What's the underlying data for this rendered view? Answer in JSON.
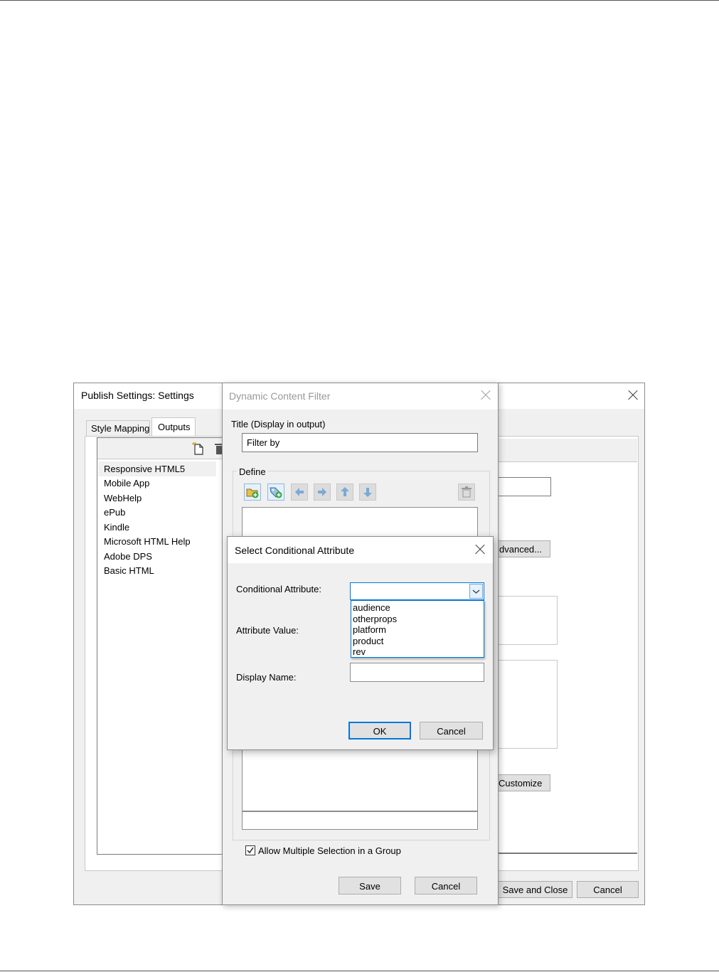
{
  "publish_settings": {
    "title": "Publish Settings: Settings",
    "tabs": [
      "Style Mapping",
      "Outputs"
    ],
    "outputs": [
      "Responsive HTML5",
      "Mobile App",
      "WebHelp",
      "ePub",
      "Kindle",
      "Microsoft HTML Help",
      "Adobe DPS",
      "Basic HTML"
    ],
    "advanced_label": "dvanced...",
    "customize_label": "Customize",
    "save_close_label": "Save and Close",
    "cancel_label": "Cancel"
  },
  "dcf": {
    "title": "Dynamic Content Filter",
    "title_label": "Title (Display in output)",
    "title_value": "Filter by",
    "define_label": "Define",
    "allow_multiple_label": "Allow Multiple Selection in a Group",
    "save_label": "Save",
    "cancel_label": "Cancel"
  },
  "sca": {
    "title": "Select Conditional Attribute",
    "attr_label": "Conditional Attribute:",
    "attr_value": "",
    "attr_options": [
      "audience",
      "otherprops",
      "platform",
      "product",
      "rev"
    ],
    "value_label": "Attribute Value:",
    "display_label": "Display Name:",
    "display_value": "",
    "ok_label": "OK",
    "cancel_label": "Cancel"
  },
  "colors": {
    "accent": "#0078d7",
    "dialog_bg": "#f0f0f0",
    "button_bg": "#e1e1e1"
  }
}
